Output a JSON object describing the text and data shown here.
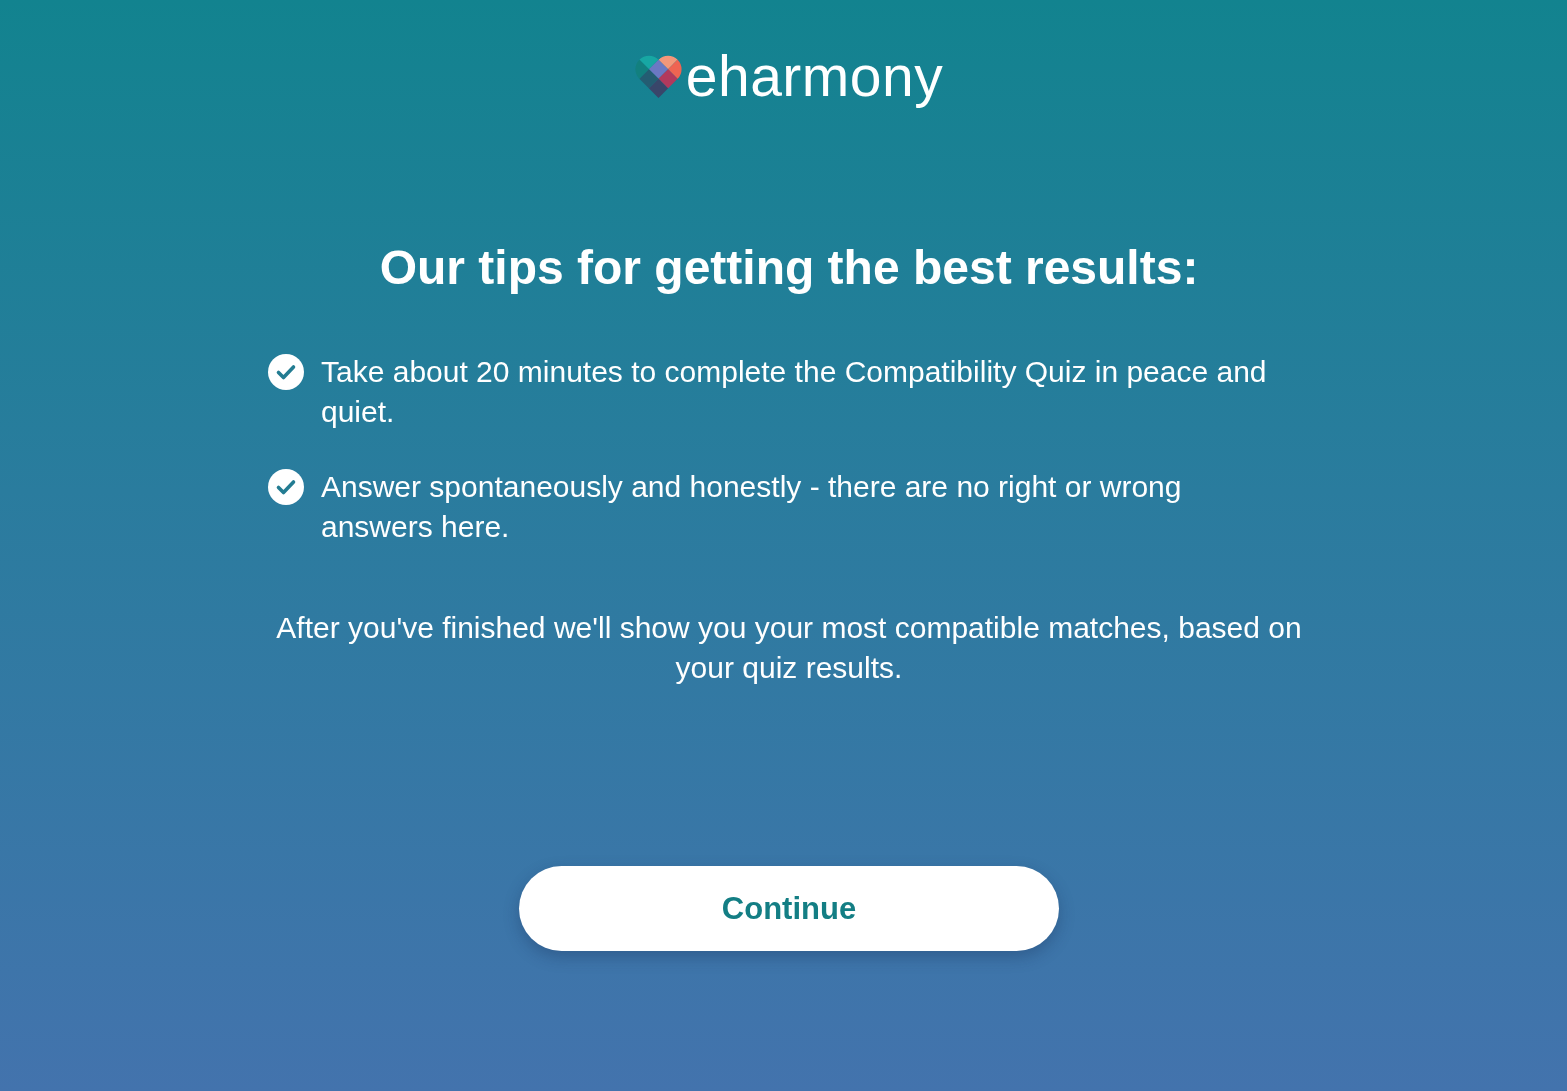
{
  "logo": {
    "text": "eharmony"
  },
  "heading": "Our tips for getting the best results:",
  "tips": [
    {
      "text": "Take about 20 minutes to complete the Compatibility Quiz in peace and quiet."
    },
    {
      "text": "Answer spontaneously and honestly - there are no right or wrong answers here."
    }
  ],
  "note": "After you've finished we'll show you your most compatible matches, based on your quiz results.",
  "button": {
    "label": "Continue"
  }
}
